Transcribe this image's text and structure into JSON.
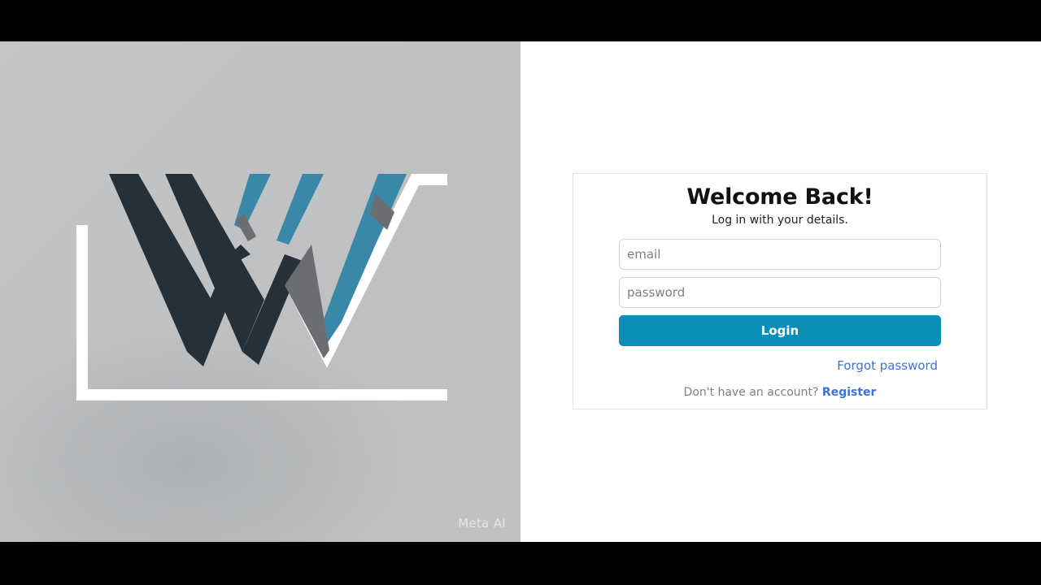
{
  "hero": {
    "watermark": "Meta AI",
    "colors": {
      "dark": "#253039",
      "blue": "#3a88a8",
      "gray": "#6b6d70",
      "frame": "#ffffff"
    }
  },
  "login": {
    "title": "Welcome Back!",
    "subtitle": "Log in with your details.",
    "email_placeholder": "email",
    "email_value": "",
    "password_placeholder": "password",
    "password_value": "",
    "login_label": "Login",
    "forgot_label": "Forgot password",
    "register_prompt": "Don't have an account?",
    "register_label": "Register",
    "accent_color": "#0a8fb8",
    "link_color": "#3b73d8"
  }
}
